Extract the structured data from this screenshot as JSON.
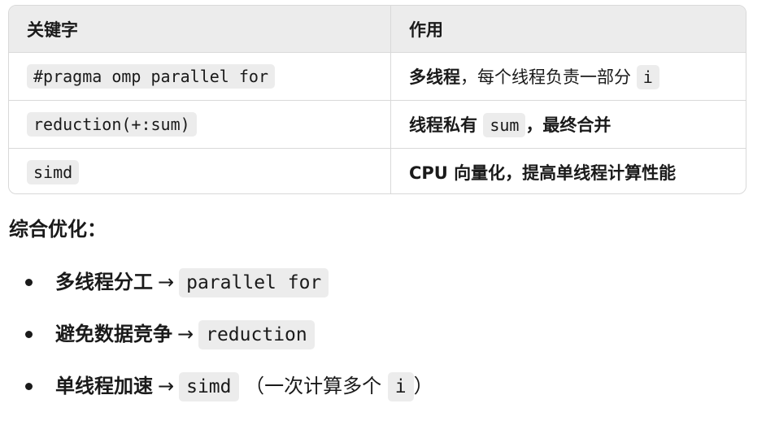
{
  "table": {
    "headers": [
      "关键字",
      "作用"
    ],
    "rows": [
      {
        "keyword": "#pragma omp parallel for",
        "desc_bold": "多线程",
        "desc_rest": "，每个线程负责一部分",
        "desc_code": "i",
        "desc_after": ""
      },
      {
        "keyword": "reduction(+:sum)",
        "desc_bold": "线程私有",
        "desc_rest": "",
        "desc_code": "sum",
        "desc_after": "，最终合并"
      },
      {
        "keyword": "simd",
        "desc_bold": "CPU 向量化，提高单线程计算性能",
        "desc_rest": "",
        "desc_code": "",
        "desc_after": ""
      }
    ]
  },
  "section": {
    "title": "综合优化："
  },
  "list": [
    {
      "label": "多线程分工",
      "arrow": "→",
      "code": "parallel for",
      "note_open": "",
      "note_code": "",
      "note_close": ""
    },
    {
      "label": "避免数据竞争",
      "arrow": "→",
      "code": "reduction",
      "note_open": "",
      "note_code": "",
      "note_close": ""
    },
    {
      "label": "单线程加速",
      "arrow": "→",
      "code": "simd",
      "note_open": "（一次计算多个",
      "note_code": "i",
      "note_close": "）"
    }
  ]
}
